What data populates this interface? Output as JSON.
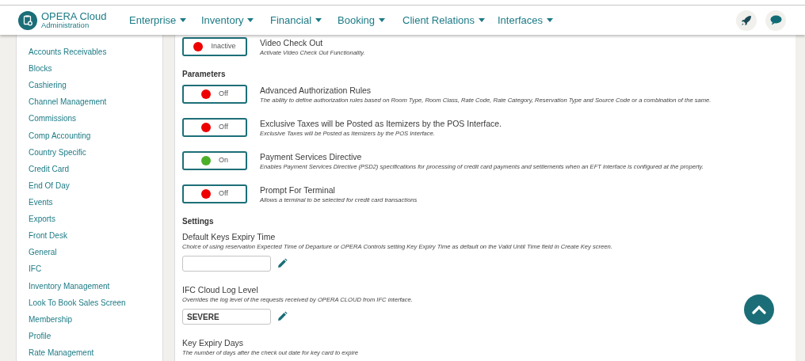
{
  "app": {
    "title": "OPERA Cloud",
    "subtitle": "Administration"
  },
  "nav": [
    {
      "label": "Enterprise"
    },
    {
      "label": "Inventory"
    },
    {
      "label": "Financial"
    },
    {
      "label": "Booking"
    },
    {
      "label": "Client Relations"
    },
    {
      "label": "Interfaces"
    }
  ],
  "sidebar": {
    "items": [
      {
        "label": "Accounts Receivables"
      },
      {
        "label": "Blocks"
      },
      {
        "label": "Cashiering"
      },
      {
        "label": "Channel Management"
      },
      {
        "label": "Commissions"
      },
      {
        "label": "Comp Accounting"
      },
      {
        "label": "Country Specific"
      },
      {
        "label": "Credit Card"
      },
      {
        "label": "End Of Day"
      },
      {
        "label": "Events"
      },
      {
        "label": "Exports"
      },
      {
        "label": "Front Desk"
      },
      {
        "label": "General"
      },
      {
        "label": "IFC"
      },
      {
        "label": "Inventory Management"
      },
      {
        "label": "Look To Book Sales Screen"
      },
      {
        "label": "Membership"
      },
      {
        "label": "Profile"
      },
      {
        "label": "Rate Management"
      }
    ]
  },
  "content": [
    {
      "kind": "toggle",
      "state": "Inactive",
      "on": false,
      "title": "Video Check Out",
      "description": "Activate Video Check Out Functionality."
    },
    {
      "kind": "heading",
      "title": "Parameters"
    },
    {
      "kind": "toggle",
      "state": "Off",
      "on": false,
      "title": "Advanced Authorization Rules",
      "description": "The ability to define authorization rules based on Room Type, Room Class, Rate Code, Rate Category, Reservation Type and Source Code or a combination of the same."
    },
    {
      "kind": "toggle",
      "state": "Off",
      "on": false,
      "title": "Exclusive Taxes will be Posted as Itemizers by the POS Interface.",
      "description": "Exclusive Taxes will be Posted as Itemizers by the POS Interface."
    },
    {
      "kind": "toggle",
      "state": "On",
      "on": true,
      "title": "Payment Services Directive",
      "description": "Enables Payment Services Directive (PSD2) specifications for processing of credit card payments and settlements when an EFT interface is configured at the property."
    },
    {
      "kind": "toggle",
      "state": "Off",
      "on": false,
      "title": "Prompt For Terminal",
      "description": "Allows a terminal to be selected for credit card transactions"
    },
    {
      "kind": "heading",
      "title": "Settings"
    },
    {
      "kind": "field",
      "title": "Default Keys Expiry Time",
      "description": "Choice of using reservation Expected Time of Departure or OPERA Controls setting Key Expiry Time as default on the Valid Until Time field in Create Key screen."
    },
    {
      "kind": "field",
      "title": "IFC Cloud Log Level",
      "description": "Overrides the log level of the requests received by OPERA CLOUD from IFC interface.",
      "value": "SEVERE"
    },
    {
      "kind": "text",
      "title": "Key Expiry Days",
      "description": "The number of days after the check out date for key card to expire"
    }
  ]
}
